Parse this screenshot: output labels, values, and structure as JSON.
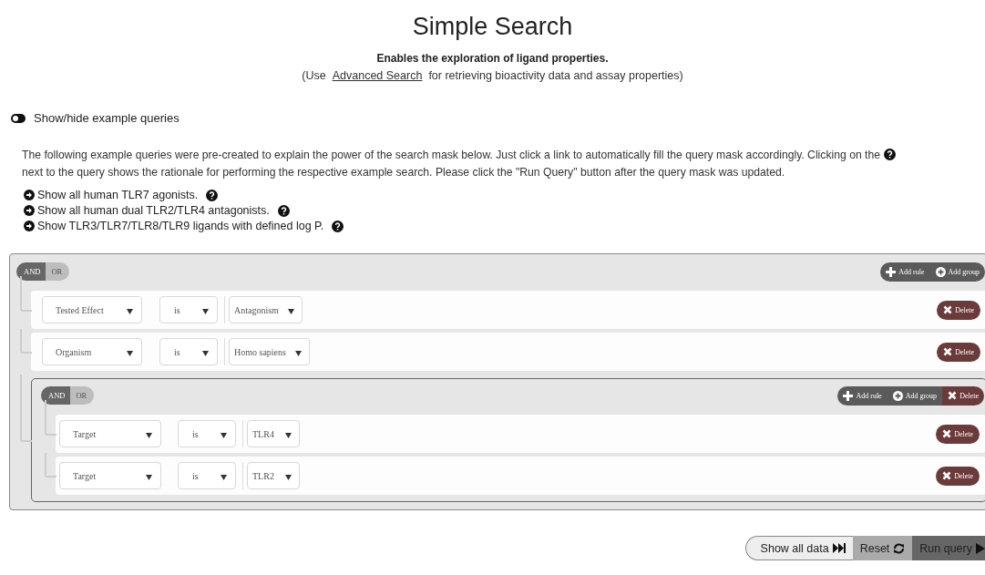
{
  "title": "Simple Search",
  "subtitle": "Enables the exploration of ligand properties.",
  "note": {
    "before": "(Use",
    "link": "Advanced Search",
    "after": "for retrieving bioactivity data and assay properties)"
  },
  "toggle_label": "Show/hide example queries",
  "description": {
    "before_icon": "The following example queries were pre-created to explain the power of the search mask below. Just click a link to automatically fill the query mask accordingly. Clicking on the",
    "after_icon": "next to the query shows the rationale for performing the respective example search. Please click the \"Run Query\" button after the query mask was updated."
  },
  "examples": [
    {
      "label": "Show all human TLR7 agonists."
    },
    {
      "label": "Show all human dual TLR2/TLR4 antagonists."
    },
    {
      "label": "Show TLR3/TLR7/TLR8/TLR9 ligands with defined log P."
    }
  ],
  "query_builder": {
    "conditions": [
      {
        "label": "AND",
        "selected": true
      },
      {
        "label": "OR",
        "selected": false
      }
    ],
    "actions": [
      {
        "kind": "add-rule",
        "label": "Add rule"
      },
      {
        "kind": "add-group",
        "label": "Add group"
      }
    ],
    "rules": [
      {
        "kind": "rule",
        "field": "Tested Effect",
        "operator": "is",
        "value": "Antagonism",
        "delete": "Delete"
      },
      {
        "kind": "rule",
        "field": "Organism",
        "operator": "is",
        "value": "Homo sapiens",
        "delete": "Delete"
      },
      {
        "kind": "group",
        "conditions": [
          {
            "label": "AND",
            "selected": true
          },
          {
            "label": "OR",
            "selected": false
          }
        ],
        "actions": [
          {
            "kind": "add-rule",
            "label": "Add rule"
          },
          {
            "kind": "add-group",
            "label": "Add group"
          },
          {
            "kind": "delete",
            "label": "Delete"
          }
        ],
        "rules": [
          {
            "kind": "rule",
            "field": "Target",
            "operator": "is",
            "value": "TLR4",
            "delete": "Delete"
          },
          {
            "kind": "rule",
            "field": "Target",
            "operator": "is",
            "value": "TLR2",
            "delete": "Delete"
          }
        ]
      }
    ]
  },
  "footer_buttons": [
    {
      "kind": "show-all",
      "label": "Show all data"
    },
    {
      "kind": "reset",
      "label": "Reset"
    },
    {
      "kind": "run",
      "label": "Run query"
    }
  ]
}
